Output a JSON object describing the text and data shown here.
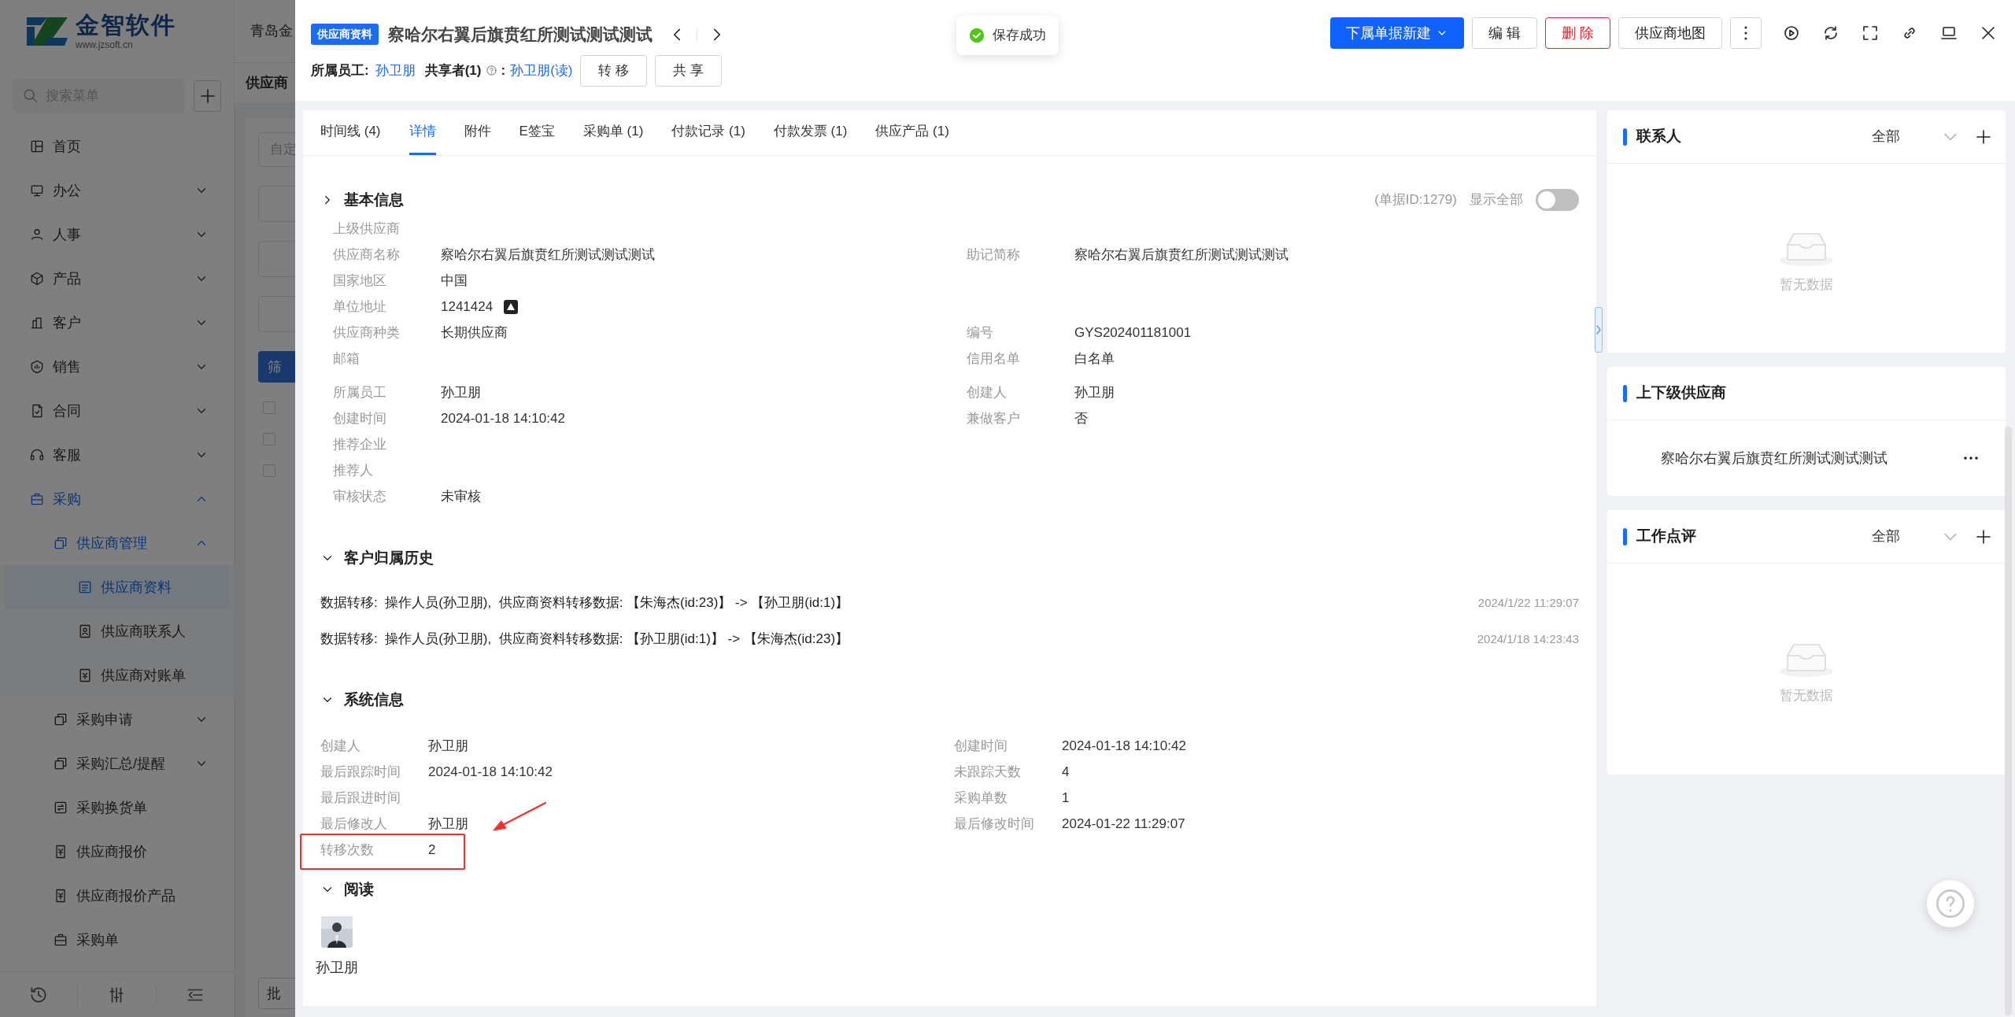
{
  "background_app": {
    "logo": {
      "name": "金智软件",
      "url": "www.jzsoft.cn"
    },
    "company": "青岛金",
    "search": {
      "placeholder": "搜索菜单"
    },
    "page_title": "供应商",
    "filter": {
      "placeholder": "自定"
    },
    "filter_button": "筛",
    "checkboxes": [
      {
        "checked": false
      },
      {
        "checked": false
      },
      {
        "checked": false
      }
    ],
    "batch_button": "批"
  },
  "sidebar": {
    "items": [
      {
        "label": "首页",
        "kind": "link",
        "selected": false
      },
      {
        "label": "办公",
        "kind": "group",
        "expanded": false,
        "selected": false
      },
      {
        "label": "人事",
        "kind": "group",
        "expanded": false,
        "selected": false
      },
      {
        "label": "产品",
        "kind": "group",
        "expanded": false,
        "selected": false
      },
      {
        "label": "客户",
        "kind": "group",
        "expanded": false,
        "selected": false
      },
      {
        "label": "销售",
        "kind": "group",
        "expanded": false,
        "selected": false
      },
      {
        "label": "合同",
        "kind": "group",
        "expanded": false,
        "selected": false
      },
      {
        "label": "客服",
        "kind": "group",
        "expanded": false,
        "selected": false
      },
      {
        "label": "采购",
        "kind": "group",
        "expanded": true,
        "selected": true,
        "children": [
          {
            "label": "供应商管理",
            "kind": "group",
            "expanded": true,
            "selected": true,
            "children": [
              {
                "label": "供应商资料",
                "kind": "link",
                "selected": true
              },
              {
                "label": "供应商联系人",
                "kind": "link",
                "selected": false
              },
              {
                "label": "供应商对账单",
                "kind": "link",
                "selected": false
              }
            ]
          },
          {
            "label": "采购申请",
            "kind": "group",
            "expanded": false,
            "selected": false
          },
          {
            "label": "采购汇总/提醒",
            "kind": "group",
            "expanded": false,
            "selected": false
          },
          {
            "label": "采购换货单",
            "kind": "link",
            "selected": false
          },
          {
            "label": "供应商报价",
            "kind": "link",
            "selected": false
          },
          {
            "label": "供应商报价产品",
            "kind": "link",
            "selected": false
          },
          {
            "label": "采购单",
            "kind": "link",
            "selected": false
          }
        ]
      }
    ]
  },
  "drawer": {
    "badge": "供应商资料",
    "title": "察哈尔右翼后旗贲红所测试测试测试",
    "owner": {
      "label": "所属员工:",
      "value": "孙卫朋"
    },
    "sharers": {
      "label": "共享者(1)",
      "separator": ":",
      "value": "孙卫朋(读)"
    },
    "actions": [
      "转 移",
      "共 享"
    ],
    "toast": "保存成功",
    "toolbar": [
      {
        "label": "下属单据新建",
        "kind": "primary-dropdown"
      },
      {
        "label": "编 辑",
        "kind": "default"
      },
      {
        "label": "删 除",
        "kind": "danger"
      },
      {
        "label": "供应商地图",
        "kind": "default"
      }
    ],
    "tabs": [
      {
        "label": "时间线 (4)",
        "selected": false
      },
      {
        "label": "详情",
        "selected": true
      },
      {
        "label": "附件",
        "selected": false
      },
      {
        "label": "E签宝",
        "selected": false
      },
      {
        "label": "采购单 (1)",
        "selected": false
      },
      {
        "label": "付款记录 (1)",
        "selected": false
      },
      {
        "label": "付款发票 (1)",
        "selected": false
      },
      {
        "label": "供应产品 (1)",
        "selected": false
      }
    ],
    "sections": [
      {
        "kind": "fields",
        "title": "基本信息",
        "expanded": false,
        "record_id": "(单据ID:1279)",
        "show_all": {
          "label": "显示全部",
          "on": false
        },
        "groups": [
          [
            {
              "left": {
                "label": "上级供应商"
              }
            },
            {
              "left": {
                "label": "供应商名称",
                "value": "察哈尔右翼后旗贲红所测试测试测试"
              },
              "right": {
                "label": "助记简称",
                "value": "察哈尔右翼后旗贲红所测试测试测试"
              }
            },
            {
              "left": {
                "label": "国家地区",
                "value": "中国"
              }
            },
            {
              "left": {
                "label": "单位地址",
                "value": "1241424",
                "kind": "address"
              }
            },
            {
              "left": {
                "label": "供应商种类",
                "value": "长期供应商"
              },
              "right": {
                "label": "编号",
                "value": "GYS202401181001"
              }
            },
            {
              "left": {
                "label": "邮箱"
              },
              "right": {
                "label": "信用名单",
                "value": "白名单"
              }
            }
          ],
          [
            {
              "left": {
                "label": "所属员工",
                "value": "孙卫朋"
              },
              "right": {
                "label": "创建人",
                "value": "孙卫朋"
              }
            },
            {
              "left": {
                "label": "创建时间",
                "value": "2024-01-18 14:10:42"
              },
              "right": {
                "label": "兼做客户",
                "value": "否"
              }
            },
            {
              "left": {
                "label": "推荐企业"
              }
            },
            {
              "left": {
                "label": "推荐人"
              }
            },
            {
              "left": {
                "label": "审核状态",
                "value": "未审核"
              }
            }
          ]
        ]
      },
      {
        "kind": "history",
        "title": "客户归属历史",
        "expanded": true,
        "entries": [
          {
            "text": "数据转移:  操作人员(孙卫朋),  供应商资料转移数据: 【朱海杰(id:23)】 -> 【孙卫朋(id:1)】",
            "time": "2024/1/22 11:29:07"
          },
          {
            "text": "数据转移:  操作人员(孙卫朋),  供应商资料转移数据: 【孙卫朋(id:1)】 -> 【朱海杰(id:23)】",
            "time": "2024/1/18 14:23:43"
          }
        ]
      },
      {
        "kind": "fields",
        "title": "系统信息",
        "expanded": true,
        "groups": [
          [
            {
              "left": {
                "label": "创建人",
                "value": "孙卫朋",
                "highlighted": false
              },
              "right": {
                "label": "创建时间",
                "value": "2024-01-18 14:10:42",
                "highlighted": false
              }
            },
            {
              "left": {
                "label": "最后跟踪时间",
                "value": "2024-01-18 14:10:42",
                "highlighted": false
              },
              "right": {
                "label": "未跟踪天数",
                "value": "4",
                "highlighted": false
              }
            },
            {
              "left": {
                "label": "最后跟进时间",
                "highlighted": false
              },
              "right": {
                "label": "采购单数",
                "value": "1",
                "highlighted": false
              }
            },
            {
              "left": {
                "label": "最后修改人",
                "value": "孙卫朋",
                "highlighted": false
              },
              "right": {
                "label": "最后修改时间",
                "value": "2024-01-22 11:29:07",
                "highlighted": false
              }
            },
            {
              "left": {
                "label": "转移次数",
                "value": "2",
                "highlighted": true
              }
            }
          ]
        ]
      },
      {
        "kind": "readers",
        "title": "阅读",
        "expanded": true,
        "readers": [
          {
            "name": "孙卫朋"
          }
        ]
      }
    ],
    "side_panels": [
      {
        "title": "联系人",
        "kind": "empty",
        "filter": "全部",
        "can_add": true,
        "empty_text": "暂无数据"
      },
      {
        "title": "上下级供应商",
        "kind": "list",
        "can_add": false,
        "items": [
          "察哈尔右翼后旗贲红所测试测试测试"
        ]
      },
      {
        "title": "工作点评",
        "kind": "empty",
        "filter": "全部",
        "can_add": true,
        "empty_text": "暂无数据"
      }
    ]
  }
}
